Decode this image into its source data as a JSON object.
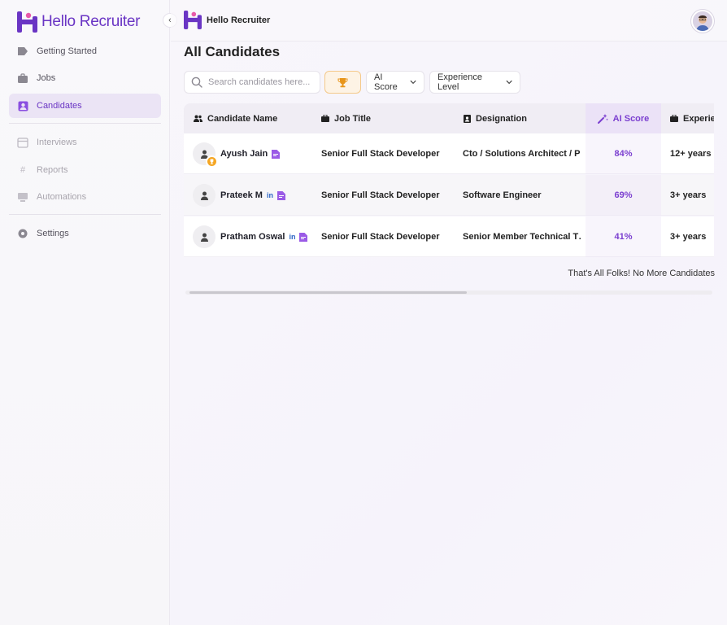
{
  "brand": {
    "name": "Hello Recruiter"
  },
  "sidebar": {
    "items": [
      {
        "label": "Getting Started"
      },
      {
        "label": "Jobs"
      },
      {
        "label": "Candidates"
      },
      {
        "label": "Interviews"
      },
      {
        "label": "Reports"
      },
      {
        "label": "Automations"
      },
      {
        "label": "Settings"
      }
    ]
  },
  "topbar": {
    "title": "Hello Recruiter"
  },
  "page": {
    "title": "All Candidates"
  },
  "toolbar": {
    "search_placeholder": "Search candidates here...",
    "ai_score_label": "AI Score",
    "experience_label": "Experience Level"
  },
  "table": {
    "headers": {
      "candidate_name": "Candidate Name",
      "job_title": "Job Title",
      "designation": "Designation",
      "ai_score": "AI Score",
      "experience": "Experience"
    },
    "rows": [
      {
        "name": "Ayush Jain",
        "job_title": "Senior Full Stack Developer",
        "designation": "Cto / Solutions Architect / P…",
        "ai_score": "84%",
        "experience": "12+ years"
      },
      {
        "name": "Prateek M",
        "job_title": "Senior Full Stack Developer",
        "designation": "Software Engineer",
        "ai_score": "69%",
        "experience": "3+ years"
      },
      {
        "name": "Pratham Oswal",
        "job_title": "Senior Full Stack Developer",
        "designation": "Senior Member Technical T…",
        "ai_score": "41%",
        "experience": "3+ years"
      }
    ],
    "linkedin_label": "in"
  },
  "end_note": "That's All Folks! No More Candidates",
  "colors": {
    "accent": "#6a35c4",
    "ai": "#7b3fd0",
    "trophy": "#f5a623"
  }
}
